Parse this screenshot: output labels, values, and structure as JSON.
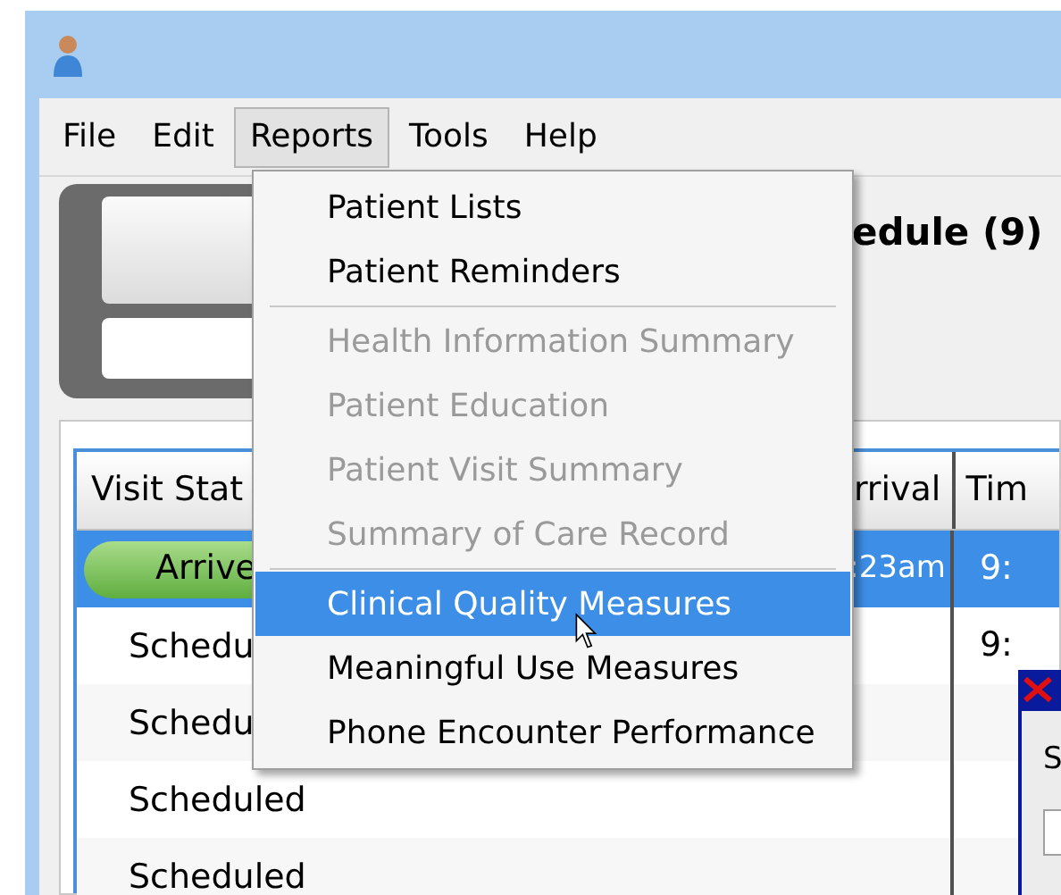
{
  "menu_bar": [
    {
      "label": "File",
      "selected": false
    },
    {
      "label": "Edit",
      "selected": false
    },
    {
      "label": "Reports",
      "selected": true
    },
    {
      "label": "Tools",
      "selected": false
    },
    {
      "label": "Help",
      "selected": false
    }
  ],
  "heading": "edule (9)",
  "table": {
    "columns": [
      "Visit Stat",
      "rrival",
      "Tim"
    ],
    "rows": [
      {
        "status": "Arrive",
        "kind": "pill",
        "arrival": ":23am",
        "time": "9:",
        "selected": true
      },
      {
        "status": "Schedu",
        "kind": "plain",
        "arrival": "",
        "time": "9:",
        "selected": false
      },
      {
        "status": "Schedu",
        "kind": "plain",
        "arrival": "",
        "time": "",
        "selected": false
      },
      {
        "status": "Scheduled",
        "kind": "plain",
        "arrival": "",
        "time": "",
        "selected": false
      },
      {
        "status": "Scheduled",
        "kind": "plain",
        "arrival": "",
        "time": "",
        "selected": false
      }
    ]
  },
  "dialog": {
    "label": "S"
  },
  "reports_menu": [
    {
      "label": "Patient Lists",
      "disabled": false,
      "selected": false
    },
    {
      "label": "Patient Reminders",
      "disabled": false,
      "selected": false,
      "separator_after": true
    },
    {
      "label": "Health Information Summary",
      "disabled": true,
      "selected": false
    },
    {
      "label": "Patient Education",
      "disabled": true,
      "selected": false
    },
    {
      "label": "Patient Visit Summary",
      "disabled": true,
      "selected": false
    },
    {
      "label": "Summary of Care Record",
      "disabled": true,
      "selected": false,
      "separator_after": true
    },
    {
      "label": "Clinical Quality Measures",
      "disabled": false,
      "selected": true
    },
    {
      "label": "Meaningful Use Measures",
      "disabled": false,
      "selected": false
    },
    {
      "label": "Phone Encounter Performance",
      "disabled": false,
      "selected": false
    }
  ]
}
